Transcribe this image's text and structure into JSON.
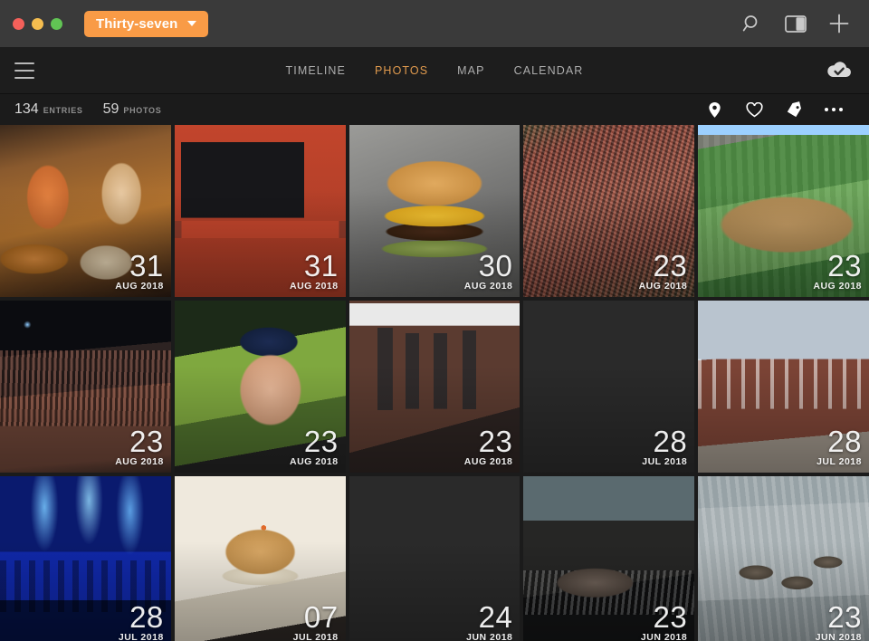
{
  "titlebar": {
    "journal_name": "Thirty-seven",
    "caret_icon": "chevron-down-icon",
    "window_controls": [
      "close",
      "minimize",
      "zoom"
    ],
    "search_icon": "search-icon",
    "sidebar_icon": "sidebar-toggle-icon",
    "add_icon": "plus-icon"
  },
  "navbar": {
    "menu_icon": "hamburger-menu-icon",
    "tabs": [
      {
        "label": "TIMELINE",
        "active": false
      },
      {
        "label": "PHOTOS",
        "active": true
      },
      {
        "label": "MAP",
        "active": false
      },
      {
        "label": "CALENDAR",
        "active": false
      }
    ],
    "sync_icon": "cloud-check-icon",
    "active_accent": "#e09a4e"
  },
  "stats": {
    "entries_count": "134",
    "entries_label": "ENTRIES",
    "photos_count": "59",
    "photos_label": "PHOTOS",
    "icons": [
      {
        "name": "location-pin-icon"
      },
      {
        "name": "heart-icon"
      },
      {
        "name": "tag-icon"
      },
      {
        "name": "more-options-icon"
      }
    ]
  },
  "grid": {
    "columns": 5,
    "photos": [
      {
        "day": "31",
        "monthyear": "AUG 2018",
        "art": "art-coffee",
        "alt": "iced-coffee-drinks-on-wooden-table"
      },
      {
        "day": "31",
        "monthyear": "AUG 2018",
        "art": "art-chalkboard",
        "alt": "elements-chalkboard-bar-sign"
      },
      {
        "day": "30",
        "monthyear": "AUG 2018",
        "art": "art-burger",
        "alt": "cheeseburger-on-paper"
      },
      {
        "day": "23",
        "monthyear": "AUG 2018",
        "art": "art-crowd",
        "alt": "stadium-crowd-in-stands"
      },
      {
        "day": "23",
        "monthyear": "AUG 2018",
        "art": "art-field",
        "alt": "baseball-field-from-stands"
      },
      {
        "day": "23",
        "monthyear": "AUG 2018",
        "art": "art-stadium-night",
        "alt": "ballpark-at-night"
      },
      {
        "day": "23",
        "monthyear": "AUG 2018",
        "art": "art-selfie",
        "alt": "selfie-with-cap-at-ballpark"
      },
      {
        "day": "23",
        "monthyear": "AUG 2018",
        "art": "art-statues",
        "alt": "baseball-player-statues-on-street"
      },
      {
        "day": "28",
        "monthyear": "JUL 2018",
        "art": "art-cheesesteak",
        "alt": "cheesesteak-sandwiches-on-blue-plate"
      },
      {
        "day": "28",
        "monthyear": "JUL 2018",
        "art": "art-hall",
        "alt": "independence-hall-building"
      },
      {
        "day": "28",
        "monthyear": "JUL 2018",
        "art": "art-concert",
        "alt": "concert-stage-with-blue-lights"
      },
      {
        "day": "07",
        "monthyear": "JUL 2018",
        "art": "art-cookie",
        "alt": "chocolate-chip-cookie-ice-cream-sandwich"
      },
      {
        "day": "24",
        "monthyear": "JUN 2018",
        "art": "art-dog",
        "alt": "black-dog-on-leash-on-sidewalk"
      },
      {
        "day": "23",
        "monthyear": "JUN 2018",
        "art": "art-zoo",
        "alt": "zoo-exhibit-with-water-and-rocks"
      },
      {
        "day": "23",
        "monthyear": "JUN 2018",
        "art": "art-otters",
        "alt": "otters-swimming-in-water"
      }
    ]
  }
}
